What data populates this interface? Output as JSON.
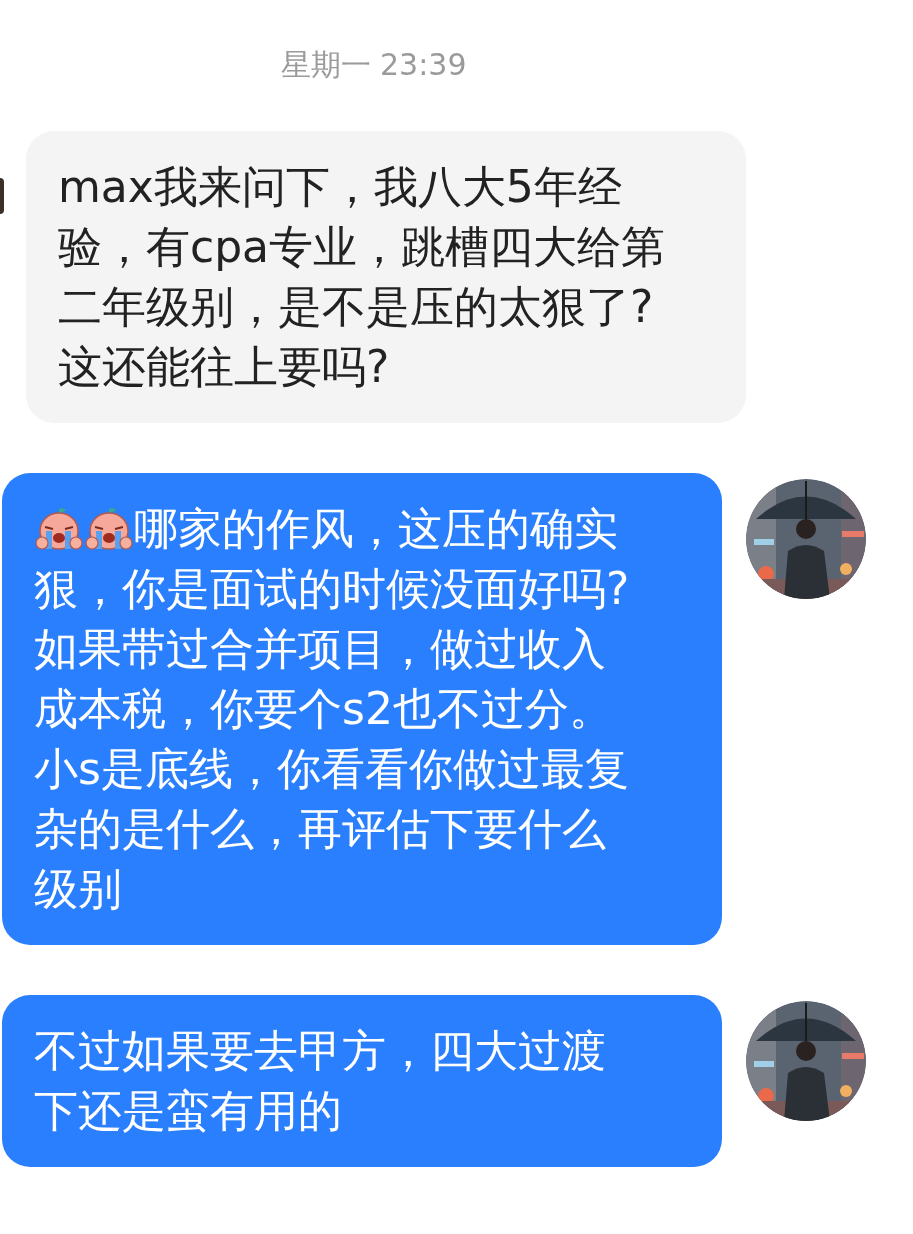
{
  "timestamp": "星期一 23:39",
  "messages": [
    {
      "kind": "incoming",
      "lines": [
        "max我来问下，我八大5年经",
        "验，有cpa专业，跳槽四大给第",
        "二年级别，是不是压的太狠了?",
        "这还能往上要吗?"
      ],
      "has_stickers": false
    },
    {
      "kind": "outgoing",
      "lines": [
        "哪家的作风，这压的确实",
        "狠，你是面试的时候没面好吗?",
        "如果带过合并项目，做过收入",
        "成本税，你要个s2也不过分。",
        "小s是底线，你看看你做过最复",
        "杂的是什么，再评估下要什么",
        "级别"
      ],
      "has_stickers": true
    },
    {
      "kind": "outgoing",
      "lines": [
        "不过如果要去甲方，四大过渡",
        "下还是蛮有用的"
      ],
      "has_stickers": false
    }
  ]
}
